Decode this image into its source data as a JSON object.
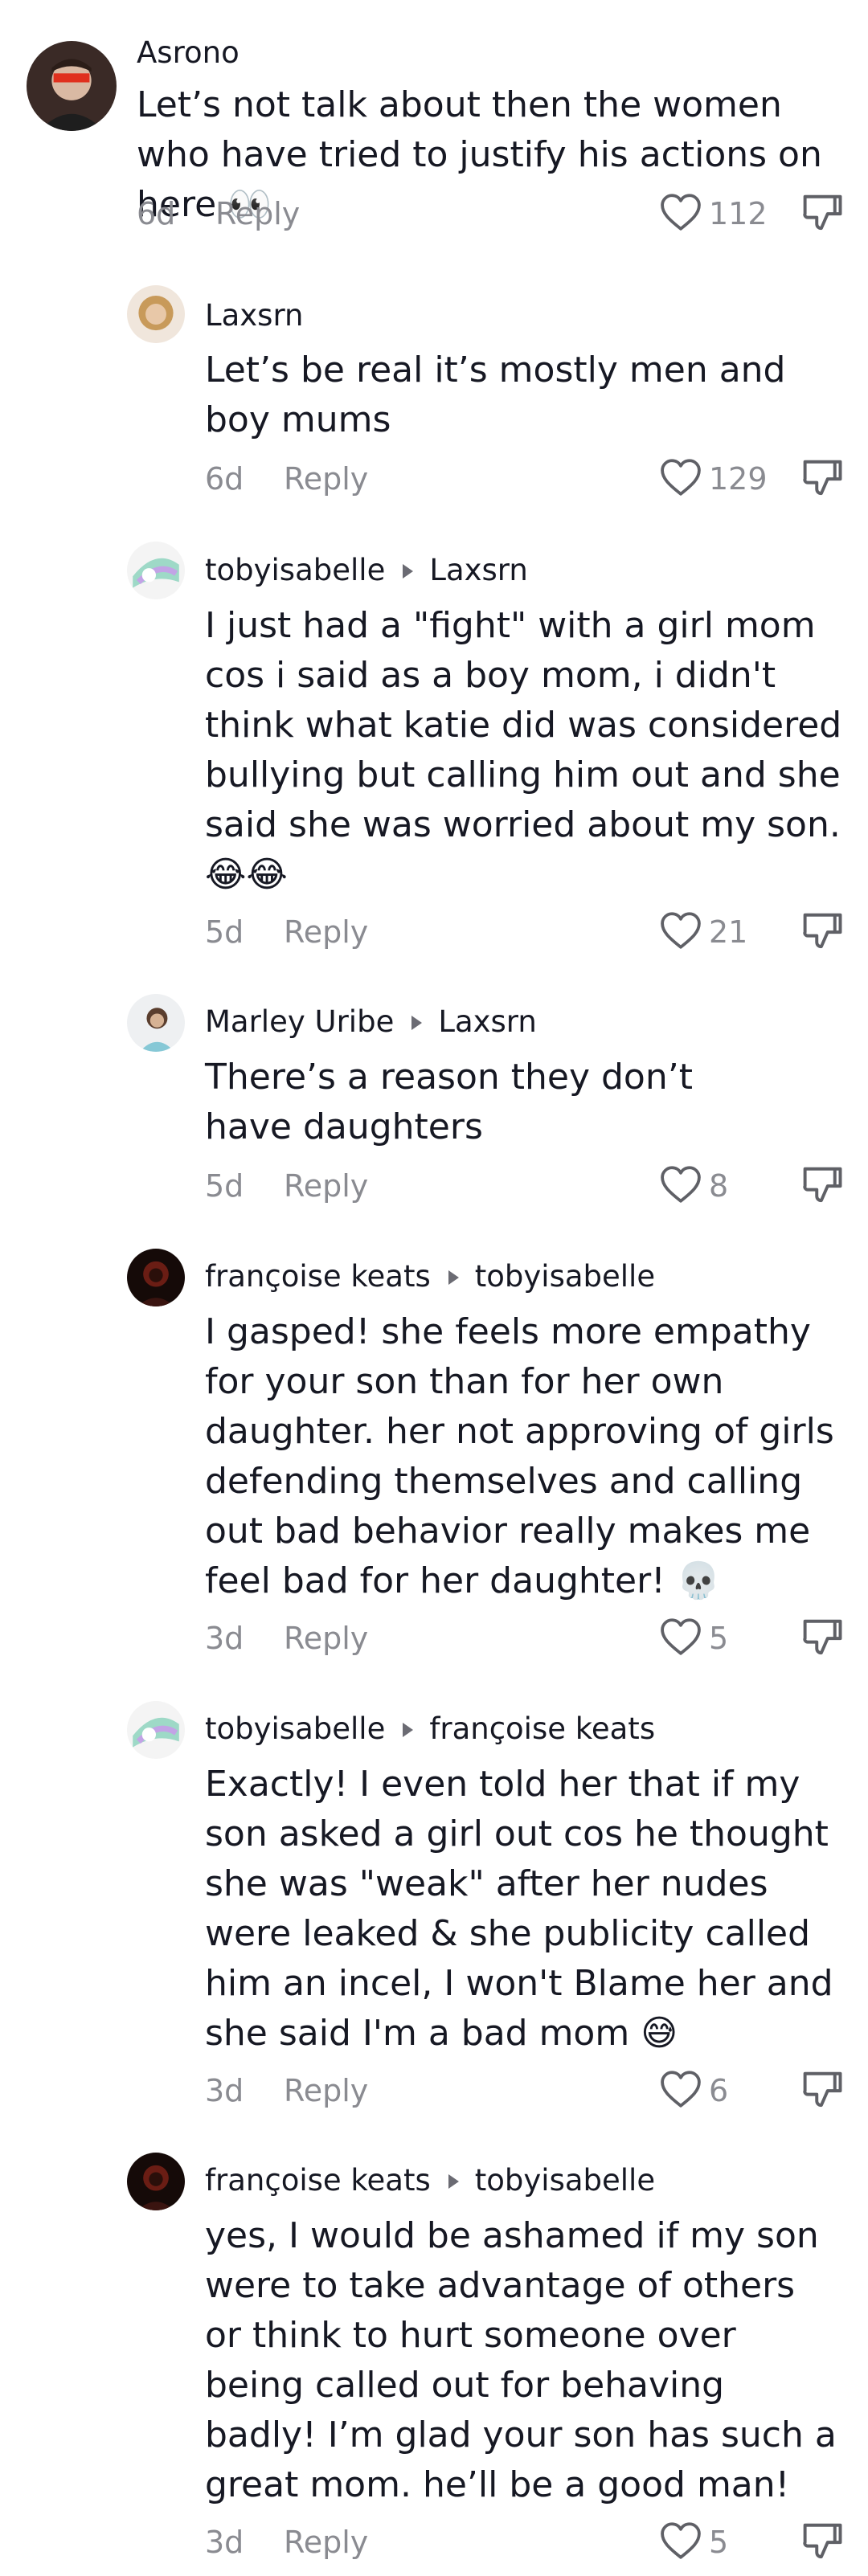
{
  "comments": [
    {
      "author": "Asrono",
      "reply_to": "",
      "text": "Let’s not talk about then the women who have tried to justify his actions on here 👀",
      "date": "6d",
      "reply_label": "Reply",
      "likes": "112"
    },
    {
      "author": "Laxsrn",
      "reply_to": "",
      "text": "Let’s be real it’s mostly men and boy mums",
      "date": "6d",
      "reply_label": "Reply",
      "likes": "129"
    },
    {
      "author": "tobyisabelle",
      "reply_to": "Laxsrn",
      "text": "I just had a \"fight\" with a girl mom cos i said as a boy mom, i didn't think what katie did was considered bullying but calling him out and she said she was worried about my son. 😂😂",
      "date": "5d",
      "reply_label": "Reply",
      "likes": "21"
    },
    {
      "author": "Marley Uribe",
      "reply_to": "Laxsrn",
      "text": "There’s a reason they don’t have daughters",
      "date": "5d",
      "reply_label": "Reply",
      "likes": "8"
    },
    {
      "author": "françoise keats",
      "reply_to": "tobyisabelle",
      "text": "I gasped! she feels more empathy for your son than for her own daughter. her not approving of girls defending themselves and calling out bad behavior really makes me feel bad for her daughter! 💀",
      "date": "3d",
      "reply_label": "Reply",
      "likes": "5"
    },
    {
      "author": "tobyisabelle",
      "reply_to": "françoise keats",
      "text": "Exactly! I even told her that if my son asked a girl out cos he thought she was \"weak\" after her nudes were leaked & she publicity called him an incel, I won't Blame her and she said I'm a bad mom 😅",
      "date": "3d",
      "reply_label": "Reply",
      "likes": "6"
    },
    {
      "author": "françoise keats",
      "reply_to": "tobyisabelle",
      "text": "yes, I would be ashamed if my son were to take advantage of others or think to hurt someone over being called out for behaving badly! I’m glad your son has such a great mom. he’ll be a good man!",
      "date": "3d",
      "reply_label": "Reply",
      "likes": "5"
    }
  ]
}
